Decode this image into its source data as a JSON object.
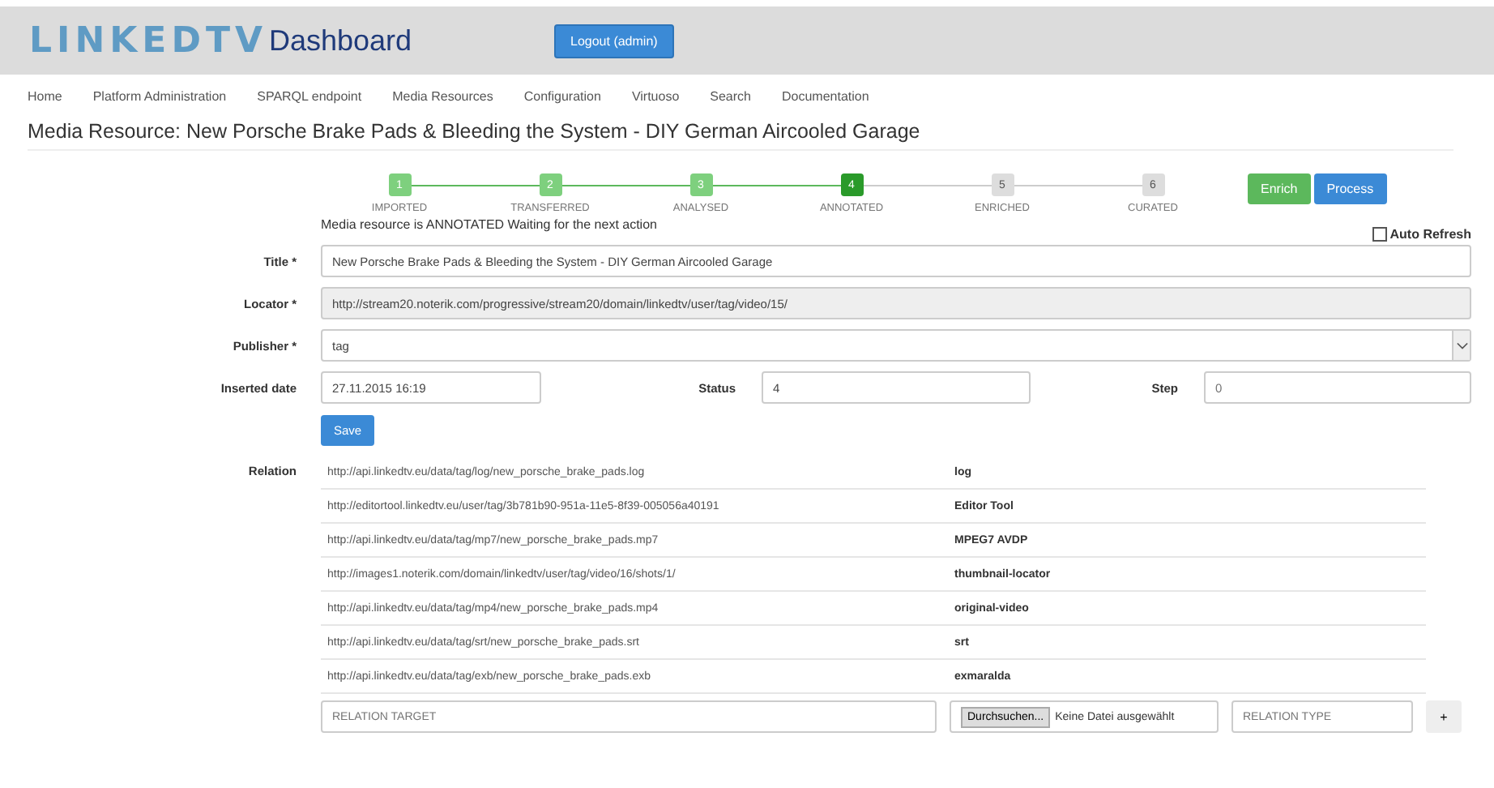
{
  "header": {
    "logo": "LINKEDTV",
    "title": "Dashboard",
    "logout_button": "Logout (admin)"
  },
  "nav": [
    "Home",
    "Platform Administration",
    "SPARQL endpoint",
    "Media Resources",
    "Configuration",
    "Virtuoso",
    "Search",
    "Documentation"
  ],
  "page_title": "Media Resource: New Porsche Brake Pads & Bleeding the System - DIY German Aircooled Garage",
  "steps": [
    {
      "number": "1",
      "label": "IMPORTED",
      "kind": "done"
    },
    {
      "number": "2",
      "label": "TRANSFERRED",
      "kind": "done"
    },
    {
      "number": "3",
      "label": "ANALYSED",
      "kind": "done"
    },
    {
      "number": "4",
      "label": "ANNOTATED",
      "kind": "current"
    },
    {
      "number": "5",
      "label": "ENRICHED",
      "kind": "pending"
    },
    {
      "number": "6",
      "label": "CURATED",
      "kind": "pending"
    }
  ],
  "actions": [
    {
      "label": "Enrich",
      "kind": "success"
    },
    {
      "label": "Process",
      "kind": "primary"
    }
  ],
  "status_message": "Media resource is ANNOTATED Waiting for the next action",
  "auto_refresh": {
    "label": "Auto Refresh",
    "checked": false
  },
  "form": {
    "title": {
      "label": "Title *",
      "value": "New Porsche Brake Pads & Bleeding the System - DIY German Aircooled Garage"
    },
    "locator": {
      "label": "Locator *",
      "value": "http://stream20.noterik.com/progressive/stream20/domain/linkedtv/user/tag/video/15/"
    },
    "publisher": {
      "label": "Publisher *",
      "value": "tag"
    },
    "inserted_date": {
      "label": "Inserted date",
      "value": "27.11.2015 16:19"
    },
    "status": {
      "label": "Status",
      "value": "4"
    },
    "step": {
      "label": "Step",
      "placeholder": "0"
    },
    "save_button": "Save"
  },
  "relation": {
    "label": "Relation",
    "rows": [
      {
        "target": "http://api.linkedtv.eu/data/tag/log/new_porsche_brake_pads.log",
        "type": "log"
      },
      {
        "target": "http://editortool.linkedtv.eu/user/tag/3b781b90-951a-11e5-8f39-005056a40191",
        "type": "Editor Tool"
      },
      {
        "target": "http://api.linkedtv.eu/data/tag/mp7/new_porsche_brake_pads.mp7",
        "type": "MPEG7 AVDP"
      },
      {
        "target": "http://images1.noterik.com/domain/linkedtv/user/tag/video/16/shots/1/",
        "type": "thumbnail-locator"
      },
      {
        "target": "http://api.linkedtv.eu/data/tag/mp4/new_porsche_brake_pads.mp4",
        "type": "original-video"
      },
      {
        "target": "http://api.linkedtv.eu/data/tag/srt/new_porsche_brake_pads.srt",
        "type": "srt"
      },
      {
        "target": "http://api.linkedtv.eu/data/tag/exb/new_porsche_brake_pads.exb",
        "type": "exmaralda"
      }
    ],
    "target_placeholder": "RELATION TARGET",
    "file_button": "Durchsuchen...",
    "file_status": "Keine Datei ausgewählt",
    "type_placeholder": "RELATION TYPE",
    "add_button": "+"
  }
}
